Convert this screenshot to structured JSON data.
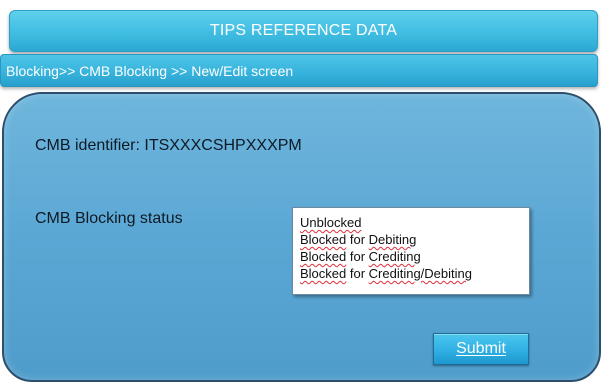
{
  "header": {
    "title": "TIPS REFERENCE DATA"
  },
  "breadcrumb": {
    "text": "Blocking>> CMB Blocking >> New/Edit screen"
  },
  "form": {
    "cmb_identifier": "CMB identifier: ITSXXXCSHPXXXPM",
    "blocking_status_label": "CMB Blocking status",
    "status_options": [
      {
        "word": "Unblocked",
        "rest": ""
      },
      {
        "word": "Blocked",
        "mid": " for ",
        "target": "Debiting"
      },
      {
        "word": "Blocked",
        "mid": " for ",
        "target": "Crediting"
      },
      {
        "word": "Blocked",
        "mid": " for ",
        "target": "Crediting/Debiting"
      }
    ],
    "submit_label": "Submit"
  },
  "colors": {
    "title_bar": "#3dbbe0",
    "breadcrumb_bar": "#35b2dc",
    "panel": "#5ba7d4",
    "panel_border": "#2e4f6b",
    "submit_button": "#2fb0e3",
    "spellcheck_underline": "#e0303a"
  }
}
